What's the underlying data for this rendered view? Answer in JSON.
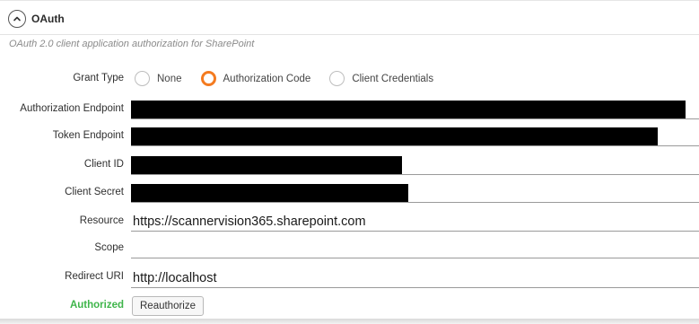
{
  "section": {
    "title": "OAuth",
    "collapse_icon": "chevron-up-icon",
    "description": "OAuth 2.0 client application authorization for SharePoint"
  },
  "grant_type": {
    "label": "Grant Type",
    "options": [
      {
        "label": "None",
        "selected": false
      },
      {
        "label": "Authorization Code",
        "selected": true
      },
      {
        "label": "Client Credentials",
        "selected": false
      }
    ],
    "accent_color": "#f47b20"
  },
  "fields": {
    "authorization_endpoint": {
      "label": "Authorization Endpoint",
      "value": "",
      "redacted": true
    },
    "token_endpoint": {
      "label": "Token Endpoint",
      "value": "",
      "redacted": true
    },
    "client_id": {
      "label": "Client ID",
      "value": "",
      "redacted": true
    },
    "client_secret": {
      "label": "Client Secret",
      "value": "",
      "redacted": true
    },
    "resource": {
      "label": "Resource",
      "value": "https://scannervision365.sharepoint.com"
    },
    "scope": {
      "label": "Scope",
      "value": ""
    },
    "redirect_uri": {
      "label": "Redirect URI",
      "value": "http://localhost"
    }
  },
  "status": {
    "label": "Authorized",
    "color": "#3eb54a",
    "reauthorize_label": "Reauthorize"
  }
}
